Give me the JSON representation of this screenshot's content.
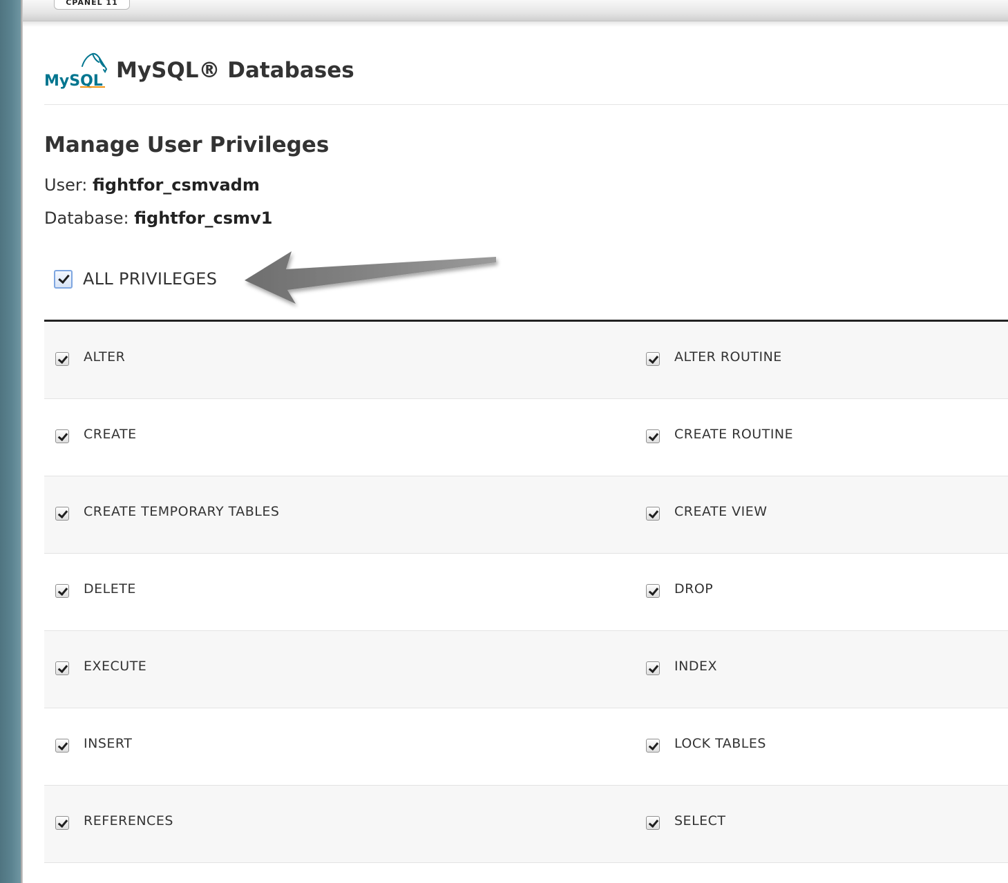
{
  "app": {
    "brand": "CPANEL 11",
    "logo_text": "MySQL"
  },
  "page": {
    "title": "MySQL® Databases",
    "section_title": "Manage User Privileges",
    "user_label": "User:",
    "user_value": "fightfor_csmvadm",
    "database_label": "Database:",
    "database_value": "fightfor_csmv1"
  },
  "all_privileges": {
    "label": "ALL PRIVILEGES",
    "checked": true
  },
  "privileges": {
    "rows": [
      [
        {
          "label": "ALTER",
          "checked": true
        },
        {
          "label": "ALTER ROUTINE",
          "checked": true
        }
      ],
      [
        {
          "label": "CREATE",
          "checked": true
        },
        {
          "label": "CREATE ROUTINE",
          "checked": true
        }
      ],
      [
        {
          "label": "CREATE TEMPORARY TABLES",
          "checked": true
        },
        {
          "label": "CREATE VIEW",
          "checked": true
        }
      ],
      [
        {
          "label": "DELETE",
          "checked": true
        },
        {
          "label": "DROP",
          "checked": true
        }
      ],
      [
        {
          "label": "EXECUTE",
          "checked": true
        },
        {
          "label": "INDEX",
          "checked": true
        }
      ],
      [
        {
          "label": "INSERT",
          "checked": true
        },
        {
          "label": "LOCK TABLES",
          "checked": true
        }
      ],
      [
        {
          "label": "REFERENCES",
          "checked": true
        },
        {
          "label": "SELECT",
          "checked": true
        }
      ]
    ]
  },
  "icons": {
    "logo": "mysql-dolphin-logo",
    "pointer": "arrow-left-icon",
    "checkbox": "checkmark-icon"
  },
  "colors": {
    "sidebar": "#5b8390",
    "title_text": "#333333",
    "table_border": "#222222",
    "row_shade": "#f7f7f7",
    "highlight_checkbox_border": "#7ea6e0",
    "arrow": "#7a7a7a",
    "logo_blue": "#00758f",
    "logo_orange": "#f29111"
  }
}
